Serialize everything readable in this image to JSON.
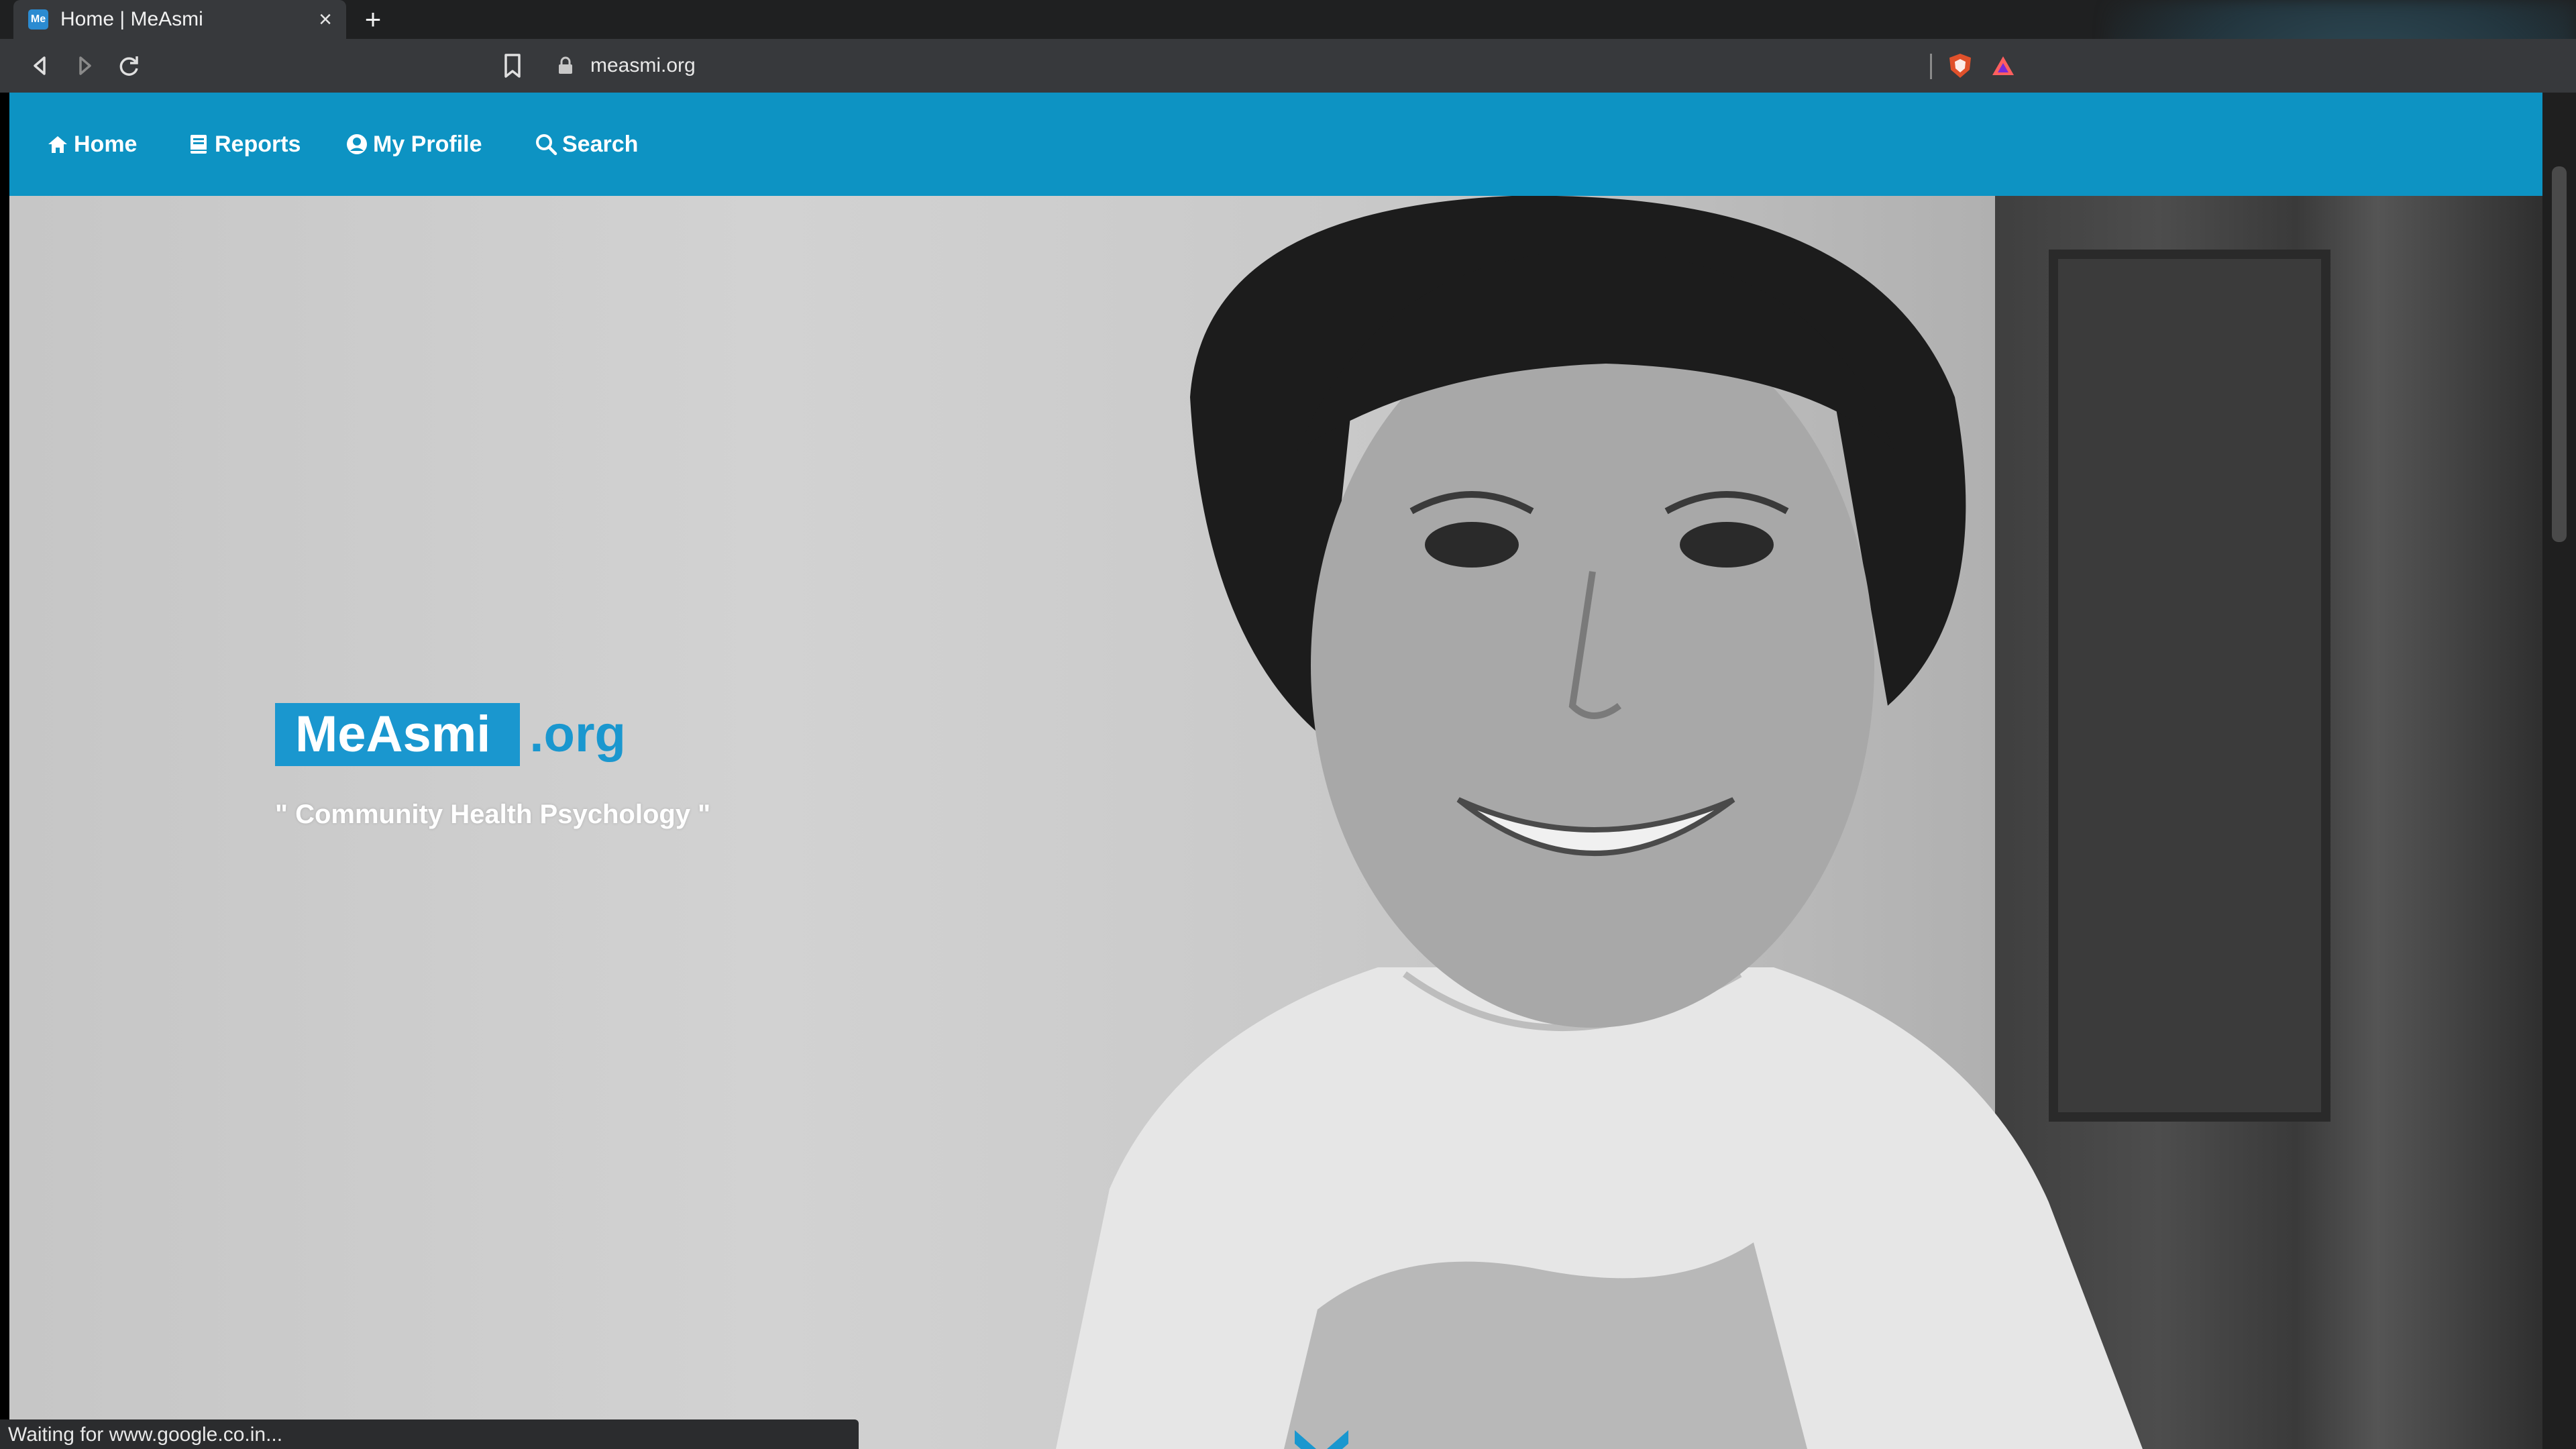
{
  "browser": {
    "tab": {
      "favicon_text": "Me",
      "title": "Home | MeAsmi",
      "close_label": "×"
    },
    "new_tab_label": "+",
    "url": "measmi.org",
    "status": "Waiting for www.google.co.in..."
  },
  "site": {
    "nav": [
      {
        "label": "Home",
        "icon": "home-icon"
      },
      {
        "label": "Reports",
        "icon": "book-icon"
      },
      {
        "label": "My Profile",
        "icon": "user-circle-icon"
      },
      {
        "label": "Search",
        "icon": "search-icon"
      }
    ],
    "brand": {
      "name": "MeAsmi",
      "suffix": ".org"
    },
    "tagline": "\" Community Health Psychology \"",
    "colors": {
      "accent": "#0d93c3",
      "brand": "#1a97cf"
    }
  }
}
